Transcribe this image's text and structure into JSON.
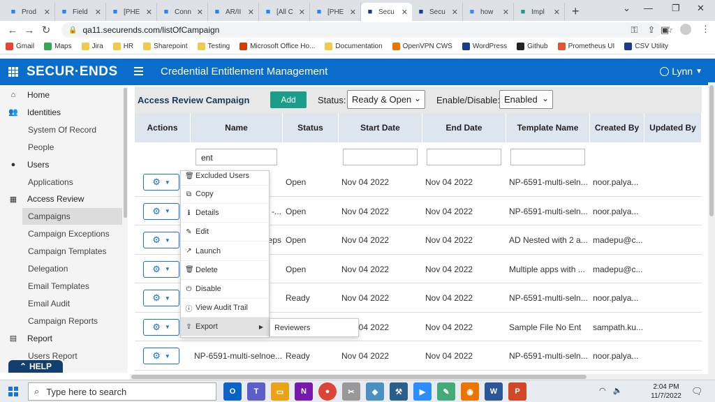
{
  "browser": {
    "tabs": [
      {
        "title": "Prod",
        "fav": "jira-icon",
        "color": "#2684ff",
        "active": false
      },
      {
        "title": "Field",
        "fav": "jira-icon",
        "color": "#2684ff",
        "active": false
      },
      {
        "title": "[PHE",
        "fav": "jira-icon",
        "color": "#2684ff",
        "active": false
      },
      {
        "title": "Conn",
        "fav": "jira-icon",
        "color": "#2684ff",
        "active": false
      },
      {
        "title": "AR/II",
        "fav": "jira-icon",
        "color": "#2684ff",
        "active": false
      },
      {
        "title": "[All C",
        "fav": "jira-icon",
        "color": "#2684ff",
        "active": false
      },
      {
        "title": "[PHE",
        "fav": "jira-icon",
        "color": "#2684ff",
        "active": false
      },
      {
        "title": "Secu",
        "fav": "securends-icon",
        "color": "#1a3a8a",
        "active": true
      },
      {
        "title": "Secu",
        "fav": "securends-icon",
        "color": "#1a3a8a",
        "active": false
      },
      {
        "title": "how",
        "fav": "google-icon",
        "color": "#4285f4",
        "active": false
      },
      {
        "title": "Impl",
        "fav": "app-icon",
        "color": "#1a9e8a",
        "active": false
      }
    ],
    "new_tab": "+",
    "url": "qa11.securends.com/listOfCampaign",
    "bookmarks": [
      {
        "label": "Gmail",
        "icon": "google-icon"
      },
      {
        "label": "Maps",
        "icon": "maps-icon"
      },
      {
        "label": "Jira",
        "icon": "folder-icon"
      },
      {
        "label": "HR",
        "icon": "folder-icon"
      },
      {
        "label": "Sharepoint",
        "icon": "folder-icon"
      },
      {
        "label": "Testing",
        "icon": "folder-icon"
      },
      {
        "label": "Microsoft Office Ho...",
        "icon": "office-icon"
      },
      {
        "label": "Documentation",
        "icon": "folder-icon"
      },
      {
        "label": "OpenVPN CWS",
        "icon": "openvpn-icon"
      },
      {
        "label": "WordPress",
        "icon": "securends-icon"
      },
      {
        "label": "Github",
        "icon": "github-icon"
      },
      {
        "label": "Prometheus UI",
        "icon": "prometheus-icon"
      },
      {
        "label": "CSV Utility",
        "icon": "securends-icon"
      }
    ]
  },
  "app": {
    "brand": "SECUR·ENDS",
    "title": "Credential Entitlement Management",
    "user": "Lynn",
    "accent": "#0a6dcc"
  },
  "sidebar": {
    "items": [
      {
        "label": "Home",
        "type": "sec",
        "icon": "home-icon"
      },
      {
        "label": "Identities",
        "type": "sec",
        "icon": "users-icon"
      },
      {
        "label": "System Of Record",
        "type": "sub"
      },
      {
        "label": "People",
        "type": "sub"
      },
      {
        "label": "Users",
        "type": "sec",
        "icon": "user-icon"
      },
      {
        "label": "Applications",
        "type": "sub"
      },
      {
        "label": "Access Review",
        "type": "sec",
        "icon": "grid-icon"
      },
      {
        "label": "Campaigns",
        "type": "sub",
        "selected": true
      },
      {
        "label": "Campaign Exceptions",
        "type": "sub"
      },
      {
        "label": "Campaign Templates",
        "type": "sub"
      },
      {
        "label": "Delegation",
        "type": "sub"
      },
      {
        "label": "Email Templates",
        "type": "sub"
      },
      {
        "label": "Email Audit",
        "type": "sub"
      },
      {
        "label": "Campaign Reports",
        "type": "sub"
      },
      {
        "label": "Report",
        "type": "sec",
        "icon": "report-icon"
      },
      {
        "label": "Users Report",
        "type": "sub"
      }
    ],
    "help": "HELP"
  },
  "toolbar": {
    "title": "Access Review Campaign",
    "add": "Add",
    "status_label": "Status:",
    "status_value": "Ready & Open",
    "enable_label": "Enable/Disable:",
    "enable_value": "Enabled"
  },
  "table": {
    "columns": [
      "Actions",
      "Name",
      "Status",
      "Start Date",
      "End Date",
      "Template Name",
      "Created By",
      "Updated By"
    ],
    "filter_name": "ent",
    "rows": [
      {
        "name": "",
        "status": "Open",
        "start": "Nov 04 2022",
        "end": "Nov 04 2022",
        "template": "NP-6591-multi-seln...",
        "created": "noor.palya..."
      },
      {
        "name": "-...",
        "status": "Open",
        "start": "Nov 04 2022",
        "end": "Nov 04 2022",
        "template": "NP-6591-multi-seln...",
        "created": "noor.palya..."
      },
      {
        "name": "eps",
        "status": "Open",
        "start": "Nov 04 2022",
        "end": "Nov 04 2022",
        "template": "AD Nested with 2 a...",
        "created": "madepu@c..."
      },
      {
        "name": "",
        "status": "Open",
        "start": "Nov 04 2022",
        "end": "Nov 04 2022",
        "template": "Multiple apps with ...",
        "created": "madepu@c..."
      },
      {
        "name": "",
        "status": "Ready",
        "start": "Nov 04 2022",
        "end": "Nov 04 2022",
        "template": "NP-6591-multi-seln...",
        "created": "noor.palya..."
      },
      {
        "name": "",
        "status": "",
        "start": "Nov 04 2022",
        "end": "Nov 04 2022",
        "template": "Sample File No Ent",
        "created": "sampath.ku..."
      },
      {
        "name": "NP-6591-multi-selnoe...",
        "status": "Ready",
        "start": "Nov 04 2022",
        "end": "Nov 04 2022",
        "template": "NP-6591-multi-seln...",
        "created": "noor.palya..."
      }
    ]
  },
  "dropdown": {
    "items": [
      {
        "label": "Excluded Users",
        "icon": "trash-icon"
      },
      {
        "label": "Copy",
        "icon": "copy-icon"
      },
      {
        "label": "Details",
        "icon": "info-icon"
      },
      {
        "label": "Edit",
        "icon": "edit-icon"
      },
      {
        "label": "Launch",
        "icon": "launch-icon"
      },
      {
        "label": "Delete",
        "icon": "trash-icon"
      },
      {
        "label": "Disable",
        "icon": "power-icon"
      },
      {
        "label": "View Audit Trail",
        "icon": "info-circle-icon"
      },
      {
        "label": "Export",
        "icon": "export-icon",
        "hover": true
      }
    ],
    "submenu": "Reviewers"
  },
  "taskbar": {
    "search": "Type here to search",
    "time": "2:04 PM",
    "date": "11/7/2022"
  }
}
